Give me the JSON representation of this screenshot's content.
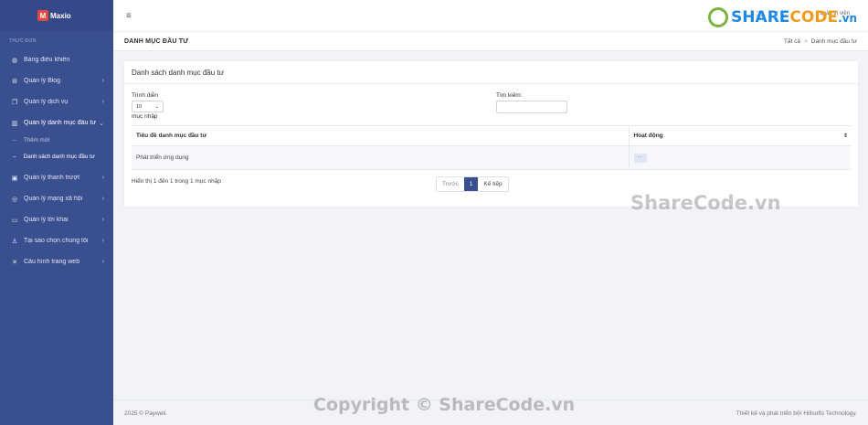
{
  "brand": {
    "logo_letter": "M",
    "name": "Maxio"
  },
  "sidebar": {
    "section_label": "THỰC ĐƠN",
    "items": [
      {
        "label": "Bảng điều khiển",
        "icon": "dashboard-icon",
        "chevron": ""
      },
      {
        "label": "Quản lý Blog",
        "icon": "blog-icon",
        "chevron": "›"
      },
      {
        "label": "Quản lý dịch vụ",
        "icon": "service-icon",
        "chevron": "›"
      },
      {
        "label": "Quản lý danh mục đầu tư",
        "icon": "chart-icon",
        "chevron": "⌄"
      }
    ],
    "sub_items": [
      {
        "label": "Thêm mới"
      },
      {
        "label": "Danh sách danh mục đầu tư"
      }
    ],
    "items_after": [
      {
        "label": "Quản lý thanh trượt",
        "icon": "image-icon",
        "chevron": "›"
      },
      {
        "label": "Quản lý mạng xã hội",
        "icon": "globe-icon",
        "chevron": "›"
      },
      {
        "label": "Quản lý lời khai",
        "icon": "comment-icon",
        "chevron": "›"
      },
      {
        "label": "Tại sao chọn chúng tôi",
        "icon": "question-icon",
        "chevron": "›"
      },
      {
        "label": "Cấu hình trang web",
        "icon": "tools-icon",
        "chevron": "›"
      }
    ]
  },
  "topbar": {
    "user_label": "quản trị viên"
  },
  "watermark": {
    "logo_share": "SHARE",
    "logo_code": "CODE",
    "logo_vn": ".vn",
    "center": "ShareCode.vn",
    "bottom": "Copyright © ShareCode.vn"
  },
  "page": {
    "title": "DANH MỤC ĐẦU TƯ",
    "breadcrumb_root": "Tất cả",
    "breadcrumb_sep": ">",
    "breadcrumb_current": "Danh mục đầu tư"
  },
  "card": {
    "title": "Danh sách danh mục đầu tư",
    "length_label": "Trình diễn",
    "length_value": "10",
    "length_suffix": "mục nhập",
    "search_label": "Tìm kiếm:",
    "search_value": "",
    "columns": [
      "Tiêu đề danh mục đầu tư",
      "Hoạt động"
    ],
    "rows": [
      {
        "title": "Phát triển ứng dụng",
        "action": "···"
      }
    ],
    "info": "Hiển thị 1 đến 1 trong 1 mục nhập",
    "pager": {
      "prev": "Trước",
      "current": "1",
      "next": "Kế tiếp"
    }
  },
  "footer": {
    "left": "2025 © Payweli.",
    "right": "Thiết kế và phát triển bởi Hillsofts Technology."
  }
}
